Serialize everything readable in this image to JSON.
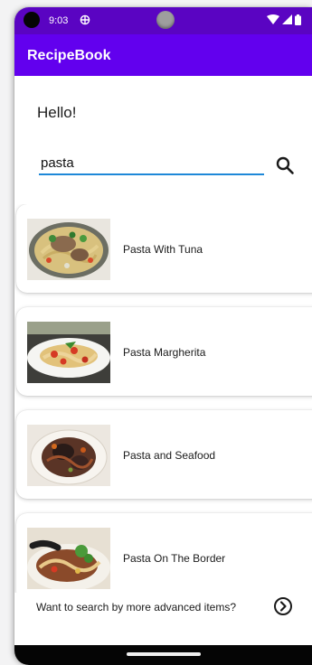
{
  "status_bar": {
    "time": "9:03",
    "icons": [
      "sync-icon",
      "wifi-icon",
      "signal-icon",
      "battery-icon"
    ]
  },
  "app_bar": {
    "title": "RecipeBook",
    "color": "#6200ee"
  },
  "greeting": "Hello!",
  "search": {
    "value": "pasta",
    "button_icon": "search-icon",
    "underline_color": "#1e88d8"
  },
  "recipes": [
    {
      "name": "Pasta With Tuna"
    },
    {
      "name": "Pasta Margherita"
    },
    {
      "name": "Pasta and Seafood"
    },
    {
      "name": "Pasta On The Border"
    }
  ],
  "advanced": {
    "text": "Want to search by more advanced items?",
    "icon": "chevron-right-circle-icon"
  }
}
